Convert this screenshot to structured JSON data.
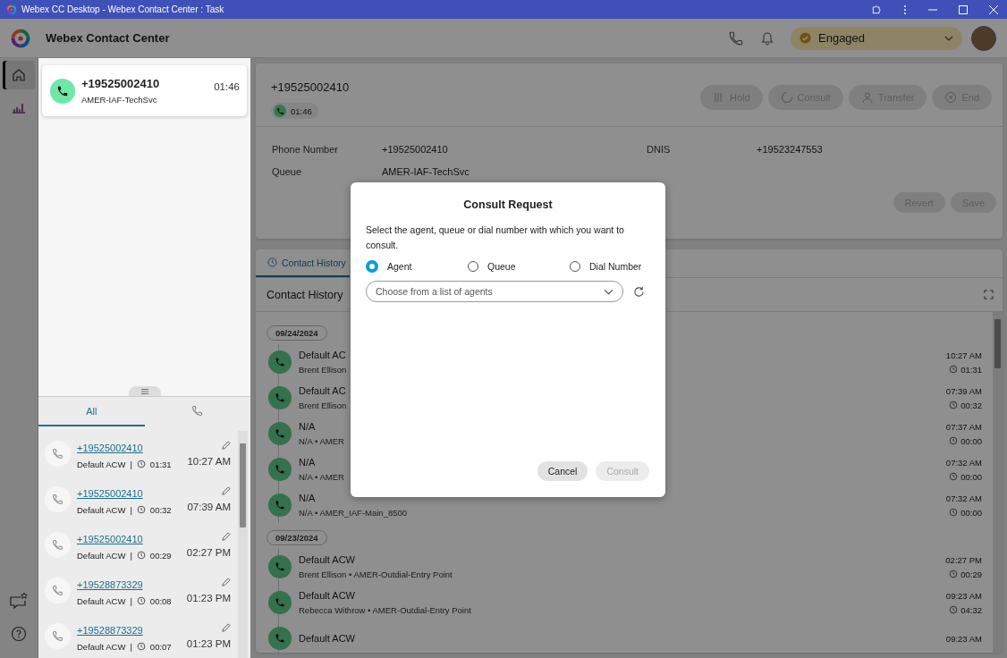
{
  "window": {
    "title": "Webex CC Desktop - Webex Contact Center : Task"
  },
  "header": {
    "app_name": "Webex Contact Center",
    "agent_state": "Engaged"
  },
  "rail": {
    "items": [
      {
        "selected": true
      },
      {
        "selected": false
      }
    ]
  },
  "task_list": [
    {
      "number": "+19525002410",
      "queue": "AMER-IAF-TechSvc",
      "timer": "01:46"
    }
  ],
  "history_tabs": [
    {
      "label": "All",
      "selected": true
    },
    {
      "selected": false
    }
  ],
  "recent_calls": [
    {
      "number": "+19525002410",
      "wrap_up": "Default ACW",
      "separator": "|",
      "duration": "01:31",
      "time": "10:27 AM"
    },
    {
      "number": "+19525002410",
      "wrap_up": "Default ACW",
      "separator": "|",
      "duration": "00:32",
      "time": "07:39 AM"
    },
    {
      "number": "+19525002410",
      "wrap_up": "Default ACW",
      "separator": "|",
      "duration": "00:29",
      "time": "02:27 PM"
    },
    {
      "number": "+19528873329",
      "wrap_up": "Default ACW",
      "separator": "|",
      "duration": "00:08",
      "time": "01:23 PM"
    },
    {
      "number": "+19528873329",
      "wrap_up": "Default ACW",
      "separator": "|",
      "duration": "00:07",
      "time": "01:23 PM"
    }
  ],
  "task": {
    "number": "+19525002410",
    "timer": "01:46",
    "actions": [
      {
        "label": "Hold",
        "disabled": true
      },
      {
        "label": "Consult",
        "disabled": true
      },
      {
        "label": "Transfer",
        "disabled": true
      },
      {
        "label": "End",
        "disabled": true
      }
    ],
    "details": [
      {
        "label": "Phone Number",
        "value": "+19525002410"
      },
      {
        "label": "DNIS",
        "value": "+19523247553"
      },
      {
        "label": "Queue",
        "value": "AMER-IAF-TechSvc"
      }
    ],
    "buttons": [
      {
        "label": "Revert",
        "disabled": true
      },
      {
        "label": "Save",
        "disabled": true
      }
    ]
  },
  "contact_history": {
    "tab": "Contact History",
    "title": "Contact History",
    "groups": [
      {
        "date": "09/24/2024",
        "entries": [
          {
            "title": "Default AC",
            "subtitle": "Brent Ellison",
            "time": "10:27 AM",
            "duration": "01:31"
          },
          {
            "title": "Default AC",
            "subtitle": "Brent Ellison",
            "time": "07:39 AM",
            "duration": "00:32"
          },
          {
            "title": "N/A",
            "subtitle": "N/A • AMER",
            "time": "07:37 AM",
            "duration": "00:00"
          },
          {
            "title": "N/A",
            "subtitle": "N/A • AMER",
            "time": "07:32 AM",
            "duration": "00:00"
          },
          {
            "title": "N/A",
            "subtitle": "N/A • AMER_IAF-Main_8500",
            "time": "07:32 AM",
            "duration": "00:00"
          }
        ]
      },
      {
        "date": "09/23/2024",
        "entries": [
          {
            "title": "Default ACW",
            "subtitle": "Brent Ellison • AMER-Outdial-Entry Point",
            "time": "02:27 PM",
            "duration": "00:29"
          },
          {
            "title": "Default ACW",
            "subtitle": "Rebecca Withrow • AMER-Outdial-Entry Point",
            "time": "09:23 AM",
            "duration": "04:32"
          },
          {
            "title": "Default ACW",
            "time": "09:23 AM"
          }
        ]
      }
    ]
  },
  "dialog": {
    "title": "Consult Request",
    "description": "Select the agent, queue or dial number with which you want to consult.",
    "options": [
      {
        "label": "Agent",
        "selected": true
      },
      {
        "label": "Queue",
        "selected": false
      },
      {
        "label": "Dial Number",
        "selected": false
      }
    ],
    "select": {
      "placeholder": "Choose from a list of agents"
    },
    "buttons": [
      {
        "label": "Cancel",
        "disabled": false
      },
      {
        "label": "Consult",
        "disabled": true
      }
    ]
  }
}
